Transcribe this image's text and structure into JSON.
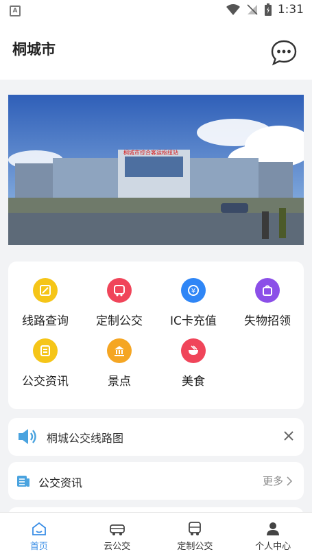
{
  "status_bar": {
    "time": "1:31",
    "notification_badge": "A"
  },
  "header": {
    "title": "桐城市"
  },
  "banner": {
    "sign_text": "桐城市综合客运枢纽站"
  },
  "grid": {
    "items": [
      {
        "label": "线路查询",
        "icon": "route-query-icon",
        "color": "#f5c518"
      },
      {
        "label": "定制公交",
        "icon": "custom-bus-icon",
        "color": "#f0455a"
      },
      {
        "label": "IC卡充值",
        "icon": "ic-card-recharge-icon",
        "color": "#2f86f6"
      },
      {
        "label": "失物招领",
        "icon": "lost-found-icon",
        "color": "#8b4fe8"
      },
      {
        "label": "公交资讯",
        "icon": "bus-news-icon",
        "color": "#f5c518"
      },
      {
        "label": "景点",
        "icon": "scenic-spot-icon",
        "color": "#f5a623"
      },
      {
        "label": "美食",
        "icon": "food-icon",
        "color": "#f0455a"
      }
    ]
  },
  "notice": {
    "text": "桐城公交线路图"
  },
  "news": {
    "title": "公交资讯",
    "more": "更多"
  },
  "tabs": [
    {
      "label": "首页",
      "icon": "home-icon",
      "active": true
    },
    {
      "label": "云公交",
      "icon": "cloud-bus-icon",
      "active": false
    },
    {
      "label": "定制公交",
      "icon": "custom-bus-tab-icon",
      "active": false
    },
    {
      "label": "个人中心",
      "icon": "person-icon",
      "active": false
    }
  ],
  "colors": {
    "accent": "#3a8ee6",
    "notice_icon": "#4aa3df"
  }
}
